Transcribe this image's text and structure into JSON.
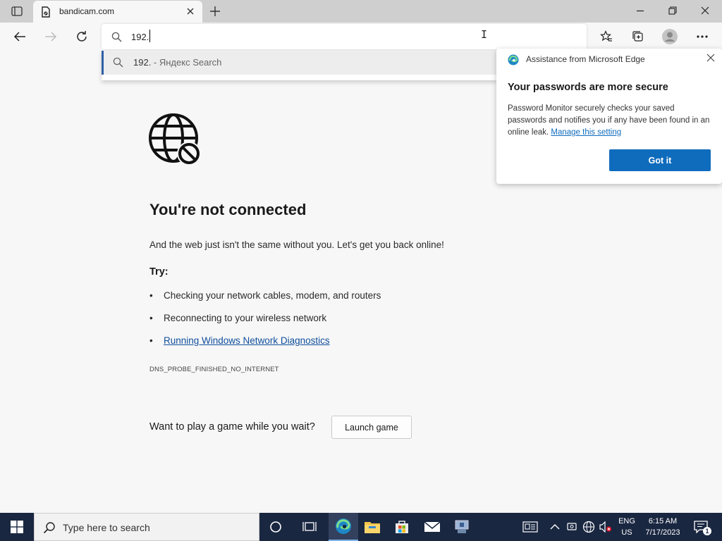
{
  "browser": {
    "tab": {
      "title": "bandicam.com",
      "favicon": "page-error-icon"
    },
    "address_bar": {
      "value": "192.",
      "search_icon": "search-icon"
    },
    "suggestion": {
      "query": "192.",
      "provider": " - Яндекс Search"
    }
  },
  "popup": {
    "header": "Assistance from Microsoft Edge",
    "title": "Your passwords are more secure",
    "body": "Password Monitor securely checks your saved passwords and notifies you if any have been found in an online leak.",
    "link": "Manage this setting",
    "button": "Got it",
    "accent": "#0f6cbd"
  },
  "error_page": {
    "heading": "You're not connected",
    "subtext": "And the web just isn't the same without you. Let's get you back online!",
    "try_label": "Try:",
    "bullets": [
      "Checking your network cables, modem, and routers",
      "Reconnecting to your wireless network",
      "Running Windows Network Diagnostics"
    ],
    "error_code": "DNS_PROBE_FINISHED_NO_INTERNET",
    "game_prompt": "Want to play a game while you wait?",
    "game_button": "Launch game"
  },
  "taskbar": {
    "search_placeholder": "Type here to search",
    "lang_top": "ENG",
    "lang_bottom": "US",
    "time": "6:15 AM",
    "date": "7/17/2023",
    "notification_count": "1",
    "background": "#1a2741"
  }
}
